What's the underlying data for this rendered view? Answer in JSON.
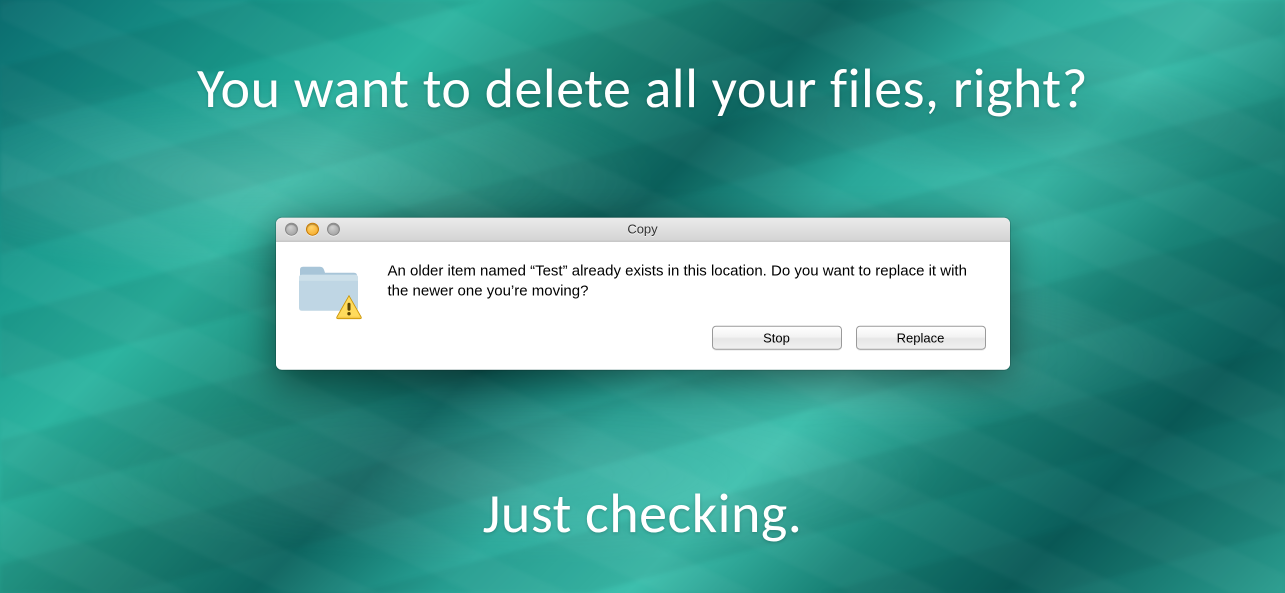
{
  "overlay": {
    "top_text": "You want to delete all your files, right?",
    "bottom_text": "Just checking."
  },
  "dialog": {
    "title": "Copy",
    "message": "An older item named “Test” already exists in this location. Do you want to replace it with the newer one you’re moving?",
    "icon": "folder-warning-icon",
    "buttons": {
      "stop": "Stop",
      "replace": "Replace"
    }
  }
}
